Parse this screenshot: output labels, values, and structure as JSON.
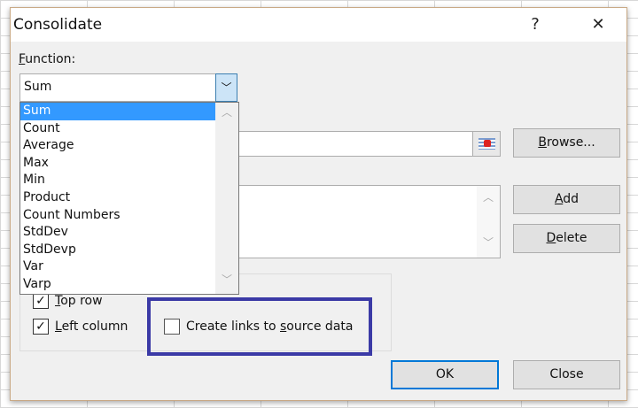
{
  "dialog": {
    "title": "Consolidate",
    "help": "?",
    "close": "✕"
  },
  "function": {
    "label_u": "F",
    "label_rest": "unction:",
    "value": "Sum",
    "options": [
      "Sum",
      "Count",
      "Average",
      "Max",
      "Min",
      "Product",
      "Count Numbers",
      "StdDev",
      "StdDevp",
      "Var",
      "Varp"
    ],
    "selected": "Sum"
  },
  "buttons": {
    "browse_u": "B",
    "browse_rest": "rowse...",
    "add_u": "A",
    "add_rest": "dd",
    "delete_u": "D",
    "delete_rest": "elete",
    "ok": "OK",
    "close": "Close"
  },
  "labels": {
    "top_row_u": "T",
    "top_row_rest": "op row",
    "top_row_checked": true,
    "left_col_u": "L",
    "left_col_rest": "eft column",
    "left_col_checked": true,
    "links_pre": "Create links to ",
    "links_u": "s",
    "links_rest": "ource data",
    "links_checked": false
  },
  "colors": {
    "highlight": "#3b3aa6",
    "selection": "#3399ff",
    "ok_border": "#0078d7"
  }
}
